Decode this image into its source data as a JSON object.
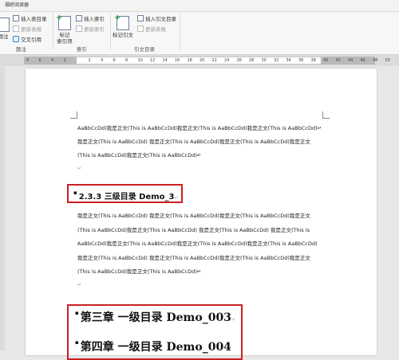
{
  "ribbon": {
    "tab_label": "福昕阅读器",
    "groups": {
      "footnote": {
        "label": "题注",
        "big_button": "题注",
        "insert_table_of_figures": "插入表目录",
        "update_table": "更新表格",
        "cross_reference": "交叉引用"
      },
      "index": {
        "label": "索引",
        "mark_entry_line1": "标记",
        "mark_entry_line2": "索引项",
        "insert_index": "插入索引",
        "update_index": "更新索引"
      },
      "citation_table": {
        "label": "引文目录",
        "mark_citation": "标记引文",
        "insert_table_of_authorities": "插入引文目录",
        "update_table": "更新表格"
      }
    }
  },
  "ruler": {
    "ticks": [
      "8",
      "6",
      "4",
      "2",
      "",
      "2",
      "4",
      "6",
      "8",
      "10",
      "12",
      "14",
      "16",
      "18",
      "20",
      "22",
      "24",
      "26",
      "28",
      "30",
      "32",
      "34",
      "36",
      "38",
      "40",
      "42",
      "44",
      "46",
      "48",
      "50"
    ]
  },
  "document": {
    "block1": [
      "AaBbCcDd)我是正文(This is AaBbCcDd)我是正文(This is AaBbCcDd)我是正文(This is AaBbCcDd)↵",
      "我是正文(This is AaBbCcDd)  我是正文(This is AaBbCcDd)我是正文(This is AaBbCcDd)我是正文",
      "(This is AaBbCcDd)我是正文(This is AaBbCcDd)↵"
    ],
    "empty_para_mark": "↵",
    "heading3": "2.3.3 三级目录 Demo_3",
    "heading3_mark": "↵",
    "block2": [
      "我是正文(This is AaBbCcDd)  我是正文(This is AaBbCcDd)我是正文(This is AaBbCcDd)我是正文",
      "(This is AaBbCcDd)我是正文(This is AaBbCcDd)  我是正文(This is AaBbCcDd)  我是正文(This is",
      "AaBbCcDd)我是正文(This is AaBbCcDd)我是正文(This is AaBbCcDd)我是正文(This is AaBbCcDd)",
      "我是正文(This is AaBbCcDd)  我是正文(This is AaBbCcDd)我是正文(This is AaBbCcDd)我是正文",
      "(This is AaBbCcDd)我是正文(This is AaBbCcDd)↵"
    ],
    "heading1_a": "第三章  一级目录 Demo_003",
    "heading1_a_mark": "↵",
    "heading1_b": "第四章  一级目录 Demo_004"
  },
  "colors": {
    "highlight_border": "#cc1f1f",
    "ribbon_bg": "#f7f7f7",
    "page_bg": "#ffffff"
  }
}
